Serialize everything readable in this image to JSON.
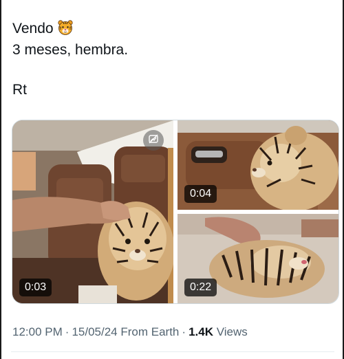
{
  "tweet": {
    "line1": "Vendo",
    "line2": "3 meses, hembra.",
    "line3": "Rt",
    "emoji_icon": "tiger-face-icon"
  },
  "media": {
    "hide_icon": "media-hide-icon",
    "videos": [
      {
        "duration": "0:03"
      },
      {
        "duration": "0:04"
      },
      {
        "duration": "0:22"
      }
    ]
  },
  "meta": {
    "time": "12:00 PM",
    "date": "15/05/24",
    "source": "From Earth",
    "separator": "·",
    "views_count": "1.4K",
    "views_label": "Views"
  },
  "colors": {
    "text": "#0f1419",
    "secondary": "#536471",
    "border": "#cfd9de"
  }
}
